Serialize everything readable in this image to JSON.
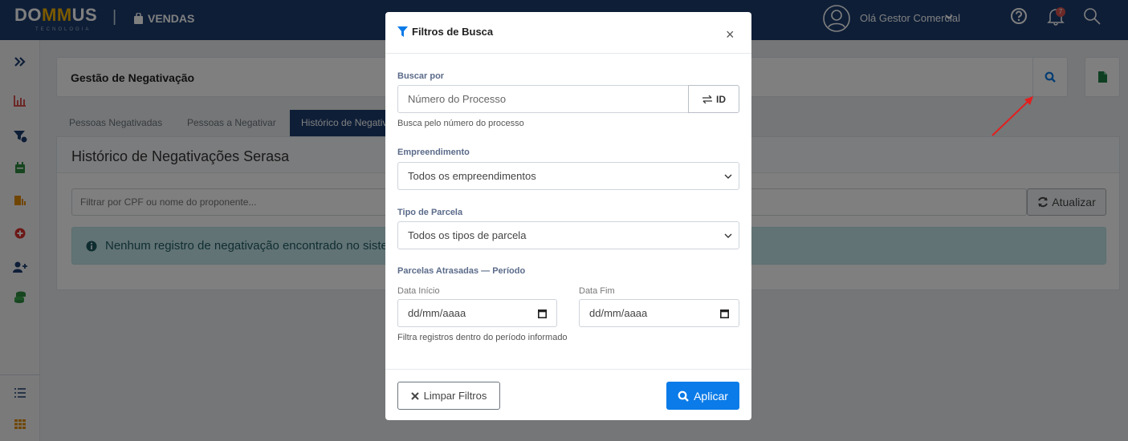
{
  "topbar": {
    "logo_part1": "DO",
    "logo_part2": "MM",
    "logo_part3": "US",
    "logo_sub": "TECNOLOGIA",
    "module": "VENDAS",
    "greeting": "Olá Gestor Comercial",
    "notification_count": "7"
  },
  "sidebar": {
    "icons": [
      "expand-icon",
      "chart-icon",
      "filter-count-icon",
      "calendar-icon",
      "door-icon",
      "plus-circle-icon",
      "user-plus-icon",
      "coins-icon",
      "list-icon",
      "grid-icon"
    ]
  },
  "page": {
    "title": "Gestão de Negativação",
    "tabs": [
      "Pessoas Negativadas",
      "Pessoas a Negativar",
      "Histórico de Negativações"
    ],
    "card_title": "Histórico de Negativações Serasa",
    "filter_placeholder": "Filtrar por CPF ou nome do proponente...",
    "refresh_label": "Atualizar",
    "alert_text": "Nenhum registro de negativação encontrado no sistema."
  },
  "modal": {
    "title": "Filtros de Busca",
    "close": "×",
    "buscar_label": "Buscar por",
    "buscar_placeholder": "Número do Processo",
    "id_label": "ID",
    "buscar_help": "Busca pelo número do processo",
    "empreendimento_label": "Empreendimento",
    "empreendimento_value": "Todos os empreendimentos",
    "tipo_label": "Tipo de Parcela",
    "tipo_value": "Todos os tipos de parcela",
    "periodo_label": "Parcelas Atrasadas — Período",
    "data_inicio_label": "Data Início",
    "data_inicio_value": "dd/mm/aaaa",
    "data_fim_label": "Data Fim",
    "data_fim_value": "dd/mm/aaaa",
    "periodo_help": "Filtra registros dentro do período informado",
    "limpar_label": "Limpar Filtros",
    "aplicar_label": "Aplicar"
  },
  "colors": {
    "navbar": "#1c3d6e",
    "accent": "#0a7be8",
    "brand_yellow": "#f7b500"
  }
}
